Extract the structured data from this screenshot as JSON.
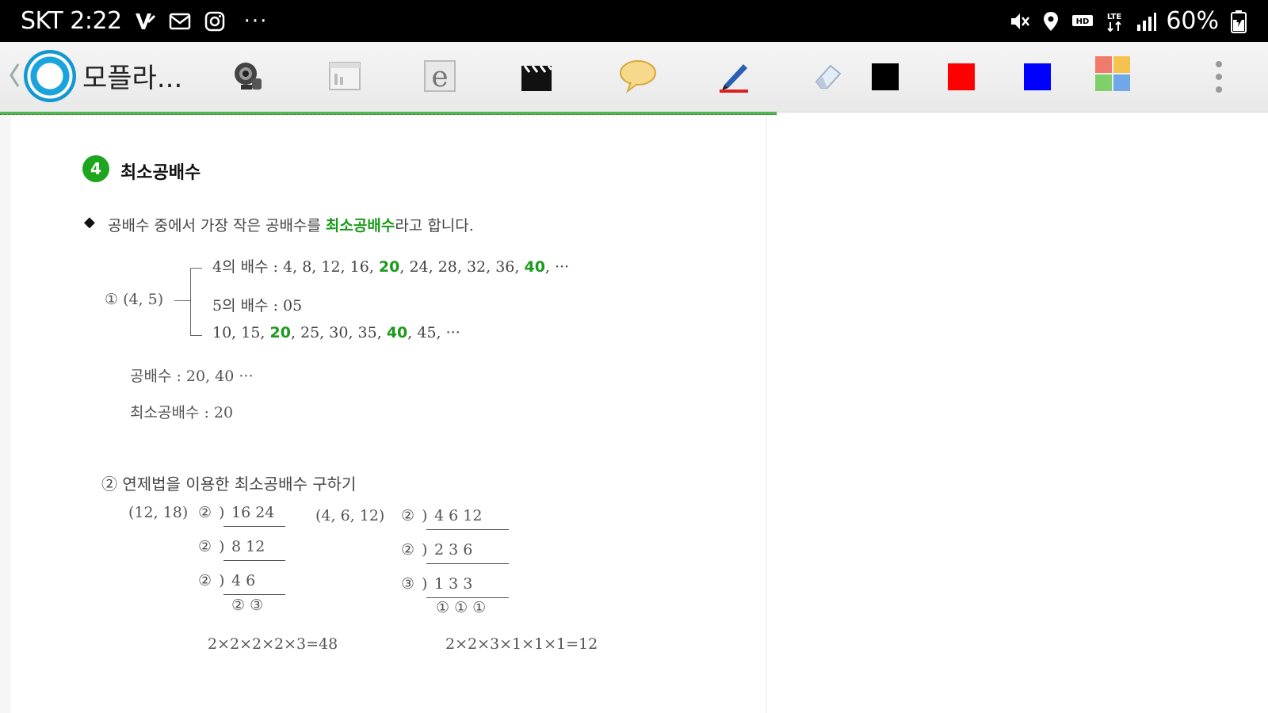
{
  "status_bar": {
    "carrier_time": "SKT 2:22",
    "more": "···",
    "battery_text": "60%",
    "icons": [
      "v-icon",
      "mail-icon",
      "instagram-icon",
      "mute-icon",
      "location-icon",
      "hd-icon",
      "lte-icon",
      "signal-icon",
      "battery-icon"
    ]
  },
  "toolbar": {
    "app_title": "모플라...",
    "tools": [
      "camera-icon",
      "board-icon",
      "browser-icon",
      "clapper-icon",
      "speech-bubble-icon",
      "pen-icon",
      "eraser-icon"
    ],
    "colors": {
      "black": "#000000",
      "red": "#ff0000",
      "blue": "#0000ff"
    },
    "palette_icon": "palette-icon",
    "more_icon": "more-vert-icon"
  },
  "document": {
    "section_number": "4",
    "section_title": "최소공배수",
    "definition": {
      "before": "공배수 중에서 가장 작은 공배수를 ",
      "highlight": "최소공배수",
      "after": "라고 합니다."
    },
    "example1": {
      "label": "① (4, 5)",
      "line1": {
        "prefix": "4의 배수 : 4, 8, 12, 16, ",
        "hl1": "20",
        "mid": ", 24, 28, 32, 36, ",
        "hl2": "40",
        "suffix": ", ···"
      },
      "line2": {
        "text": "5의 배수 : 05"
      },
      "line3": {
        "prefix": "10, 15, ",
        "hl1": "20",
        "mid": ", 25, 30, 35, ",
        "hl2": "40",
        "suffix": ", 45, ···"
      },
      "common": "공배수 : 20, 40 ···",
      "lcm": "최소공배수 : 20"
    },
    "example2": {
      "title": "② 연제법을 이용한 최소공배수 구하기",
      "left": {
        "label": "(12, 18)",
        "rows": [
          {
            "div": "②",
            "values": "16 24"
          },
          {
            "div": "②",
            "values": "8  12"
          },
          {
            "div": "②",
            "values": "4  6"
          }
        ],
        "remainders": "② ③",
        "result": "2×2×2×2×3=48"
      },
      "right": {
        "label": "(4, 6, 12)",
        "rows": [
          {
            "div": "②",
            "values": "4  6  12"
          },
          {
            "div": "②",
            "values": "2  3  6"
          },
          {
            "div": "③",
            "values": "1  3  3"
          }
        ],
        "remainders": "① ① ①",
        "result": "2×2×3×1×1×1=12"
      }
    }
  }
}
